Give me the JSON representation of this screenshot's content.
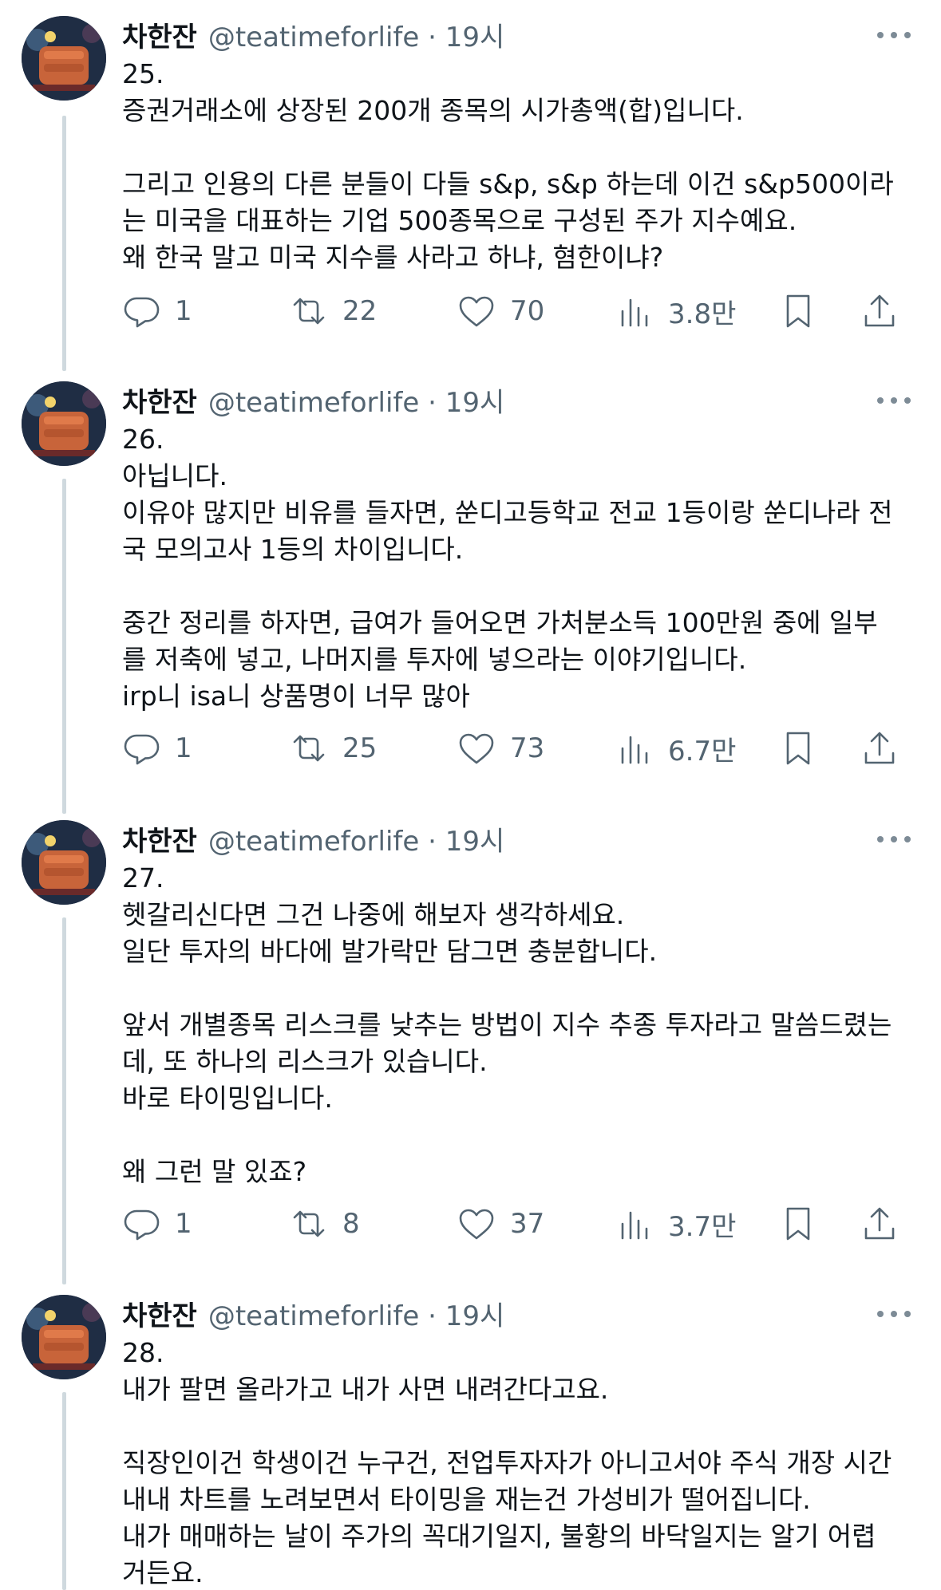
{
  "tweets": [
    {
      "name": "차한잔",
      "handle": "@teatimeforlife · 19시",
      "text": "25.\n증권거래소에 상장된 200개 종목의 시가총액(합)입니다.\n\n그리고 인용의 다른 분들이 다들 s&p, s&p 하는데 이건 s&p500이라\n는 미국을 대표하는 기업 500종목으로 구성된 주가 지수예요.\n왜 한국 말고 미국 지수를 사라고 하냐, 혐한이냐?",
      "replies": "1",
      "retweets": "22",
      "likes": "70",
      "views": "3.8만"
    },
    {
      "name": "차한잔",
      "handle": "@teatimeforlife · 19시",
      "text": "26.\n아닙니다.\n이유야 많지만 비유를 들자면, 쑨디고등학교 전교 1등이랑 쑨디나라 전\n국 모의고사 1등의 차이입니다.\n\n중간 정리를 하자면, 급여가 들어오면 가처분소득 100만원 중에 일부\n를 저축에 넣고, 나머지를 투자에 넣으라는 이야기입니다.\nirp니 isa니 상품명이 너무 많아",
      "replies": "1",
      "retweets": "25",
      "likes": "73",
      "views": "6.7만"
    },
    {
      "name": "차한잔",
      "handle": "@teatimeforlife · 19시",
      "text": "27.\n헷갈리신다면 그건 나중에 해보자 생각하세요.\n일단 투자의 바다에 발가락만 담그면 충분합니다.\n\n앞서 개별종목 리스크를 낮추는 방법이 지수 추종 투자라고 말씀드렸는\n데, 또 하나의 리스크가 있습니다.\n바로 타이밍입니다.\n\n왜 그런 말 있죠?",
      "replies": "1",
      "retweets": "8",
      "likes": "37",
      "views": "3.7만"
    },
    {
      "name": "차한잔",
      "handle": "@teatimeforlife · 19시",
      "text": "28.\n내가 팔면 올라가고 내가 사면 내려간다고요.\n\n직장인이건 학생이건 누구건, 전업투자자가 아니고서야 주식 개장 시간\n내내 차트를 노려보면서 타이밍을 재는건 가성비가 떨어집니다.\n내가 매매하는 날이 주가의 꼭대기일지, 불황의 바닥일지는 알기 어렵\n거든요."
    }
  ]
}
